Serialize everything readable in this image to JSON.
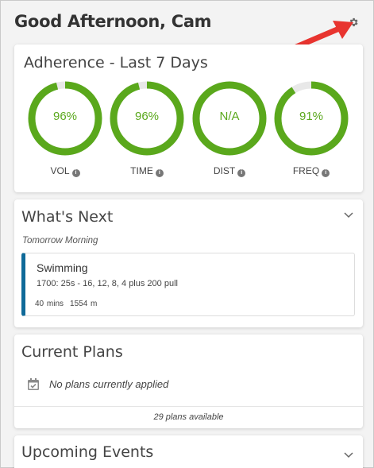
{
  "header": {
    "greeting": "Good Afternoon, Cam"
  },
  "adherence": {
    "title": "Adherence - Last 7 Days",
    "metrics": [
      {
        "label": "VOL",
        "value": "96%",
        "percent": 96
      },
      {
        "label": "TIME",
        "value": "96%",
        "percent": 96
      },
      {
        "label": "DIST",
        "value": "N/A",
        "percent": 100
      },
      {
        "label": "FREQ",
        "value": "91%",
        "percent": 91
      }
    ]
  },
  "whats_next": {
    "title": "What's Next",
    "subtitle": "Tomorrow Morning",
    "workout": {
      "type": "Swimming",
      "description": "1700: 25s - 16, 12, 8, 4 plus 200 pull",
      "duration": "40 mins",
      "distance": "1554 m"
    }
  },
  "current_plans": {
    "title": "Current Plans",
    "empty_text": "No plans currently applied",
    "available_text": "29 plans available"
  },
  "upcoming_events": {
    "title": "Upcoming Events"
  },
  "colors": {
    "ring": "#5aa81c",
    "ring_track": "#e8e8e8",
    "workout_accent": "#0f6a99",
    "arrow": "#e8342f"
  },
  "icons": [
    "gear-icon",
    "info-icon",
    "chevron-down-icon",
    "calendar-check-icon"
  ]
}
